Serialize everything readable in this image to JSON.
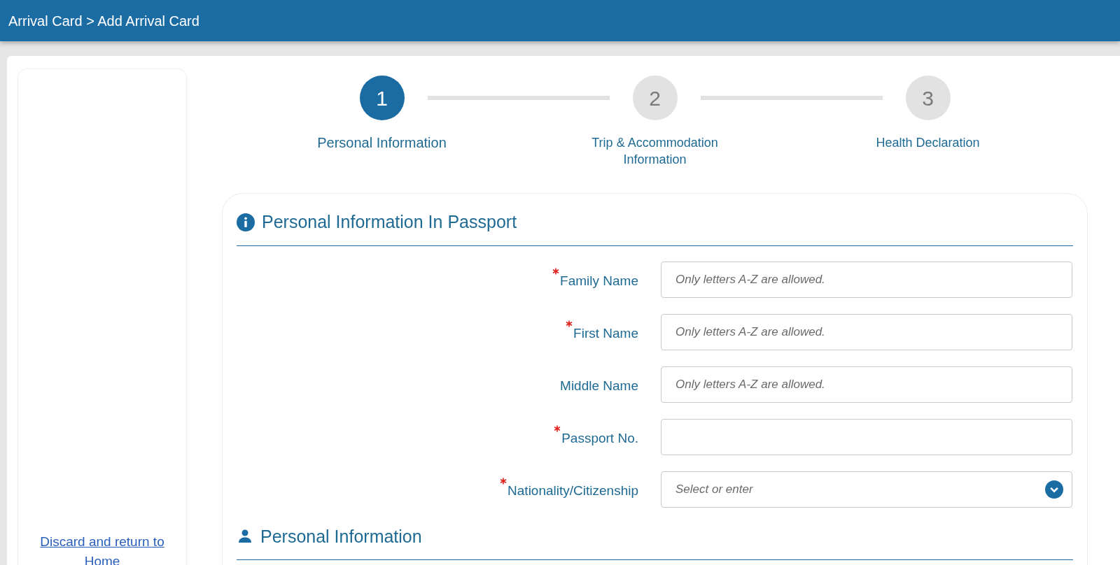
{
  "header": {
    "breadcrumb": "Arrival Card > Add Arrival Card"
  },
  "sidebar": {
    "link": "Discard and return to Home"
  },
  "steps": [
    {
      "number": "1",
      "label": "Personal Information",
      "selected": true
    },
    {
      "number": "2",
      "label": "Trip & Accommodation Information",
      "selected": false
    },
    {
      "number": "3",
      "label": "Health Declaration",
      "selected": false
    }
  ],
  "sections": [
    {
      "title": "Personal Information In Passport",
      "kind": "info",
      "fields": [
        {
          "label": "Family Name",
          "required": true,
          "kind": "text",
          "placeholder": "Only letters A-Z are allowed."
        },
        {
          "label": "First Name",
          "required": true,
          "kind": "text",
          "placeholder": "Only letters A-Z are allowed."
        },
        {
          "label": "Middle Name",
          "required": false,
          "kind": "text",
          "placeholder": "Only letters A-Z are allowed."
        },
        {
          "label": "Passport No.",
          "required": true,
          "kind": "text"
        },
        {
          "label": "Nationality/Citizenship",
          "required": true,
          "kind": "select",
          "placeholder": "Select or enter"
        }
      ]
    },
    {
      "title": "Personal Information",
      "kind": "person"
    }
  ]
}
